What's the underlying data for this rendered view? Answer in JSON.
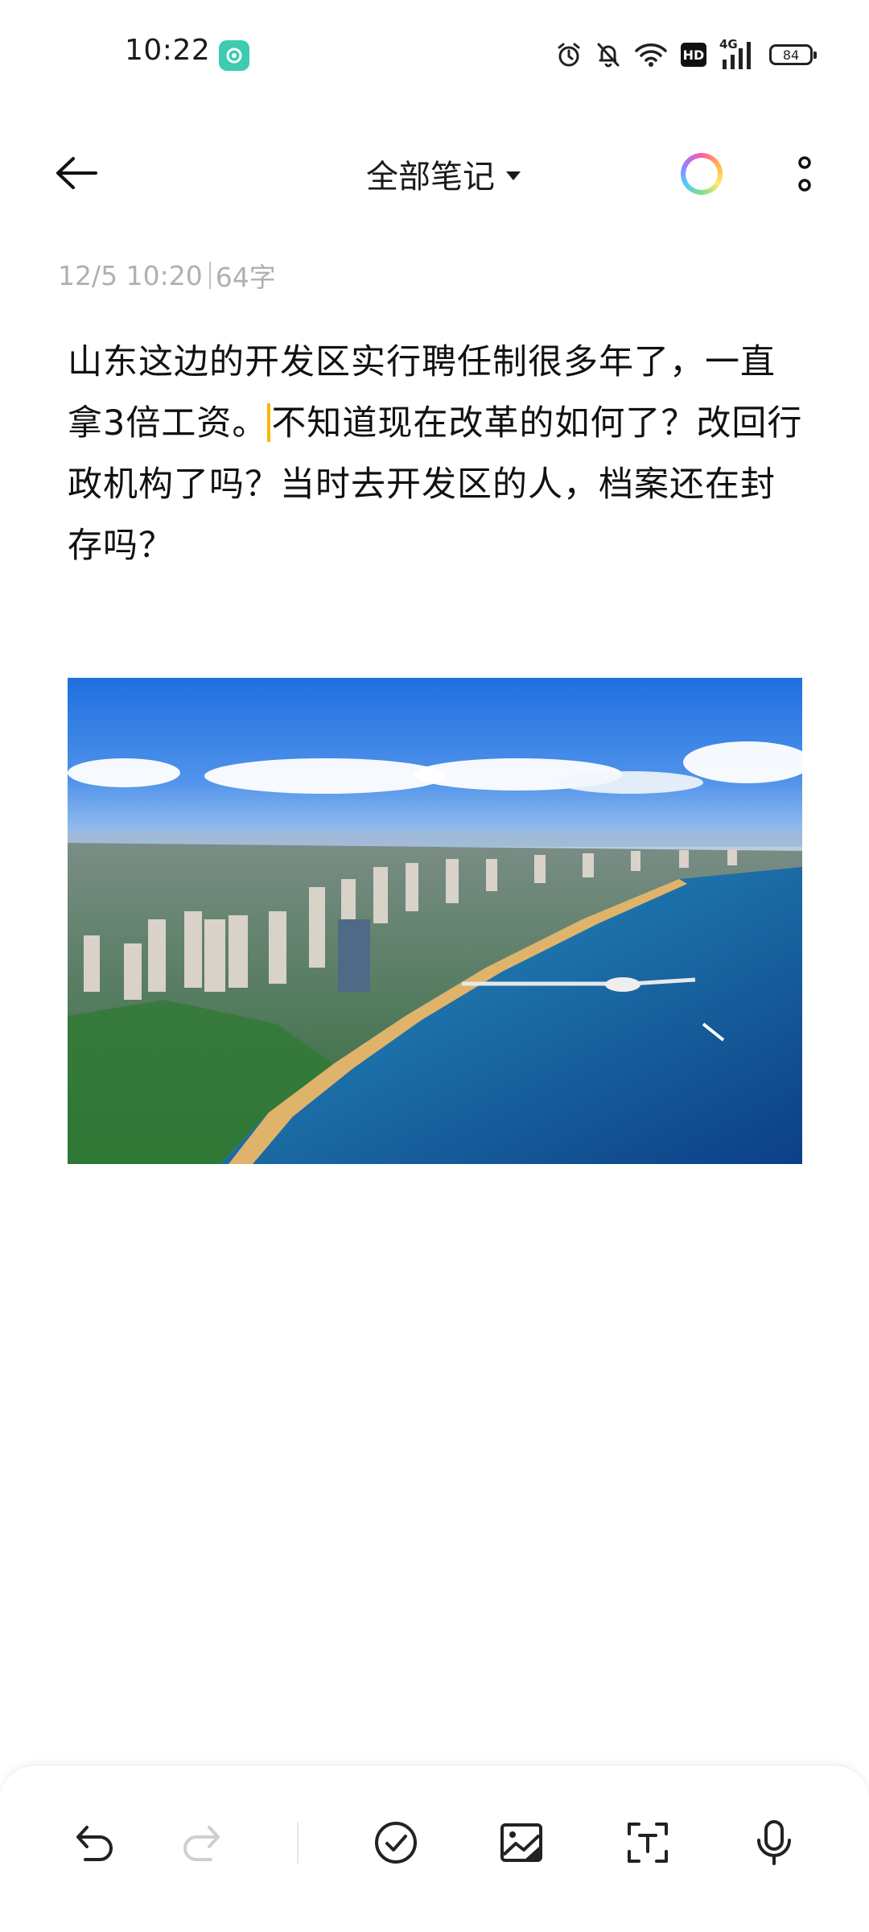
{
  "status_bar": {
    "time": "10:22",
    "hd_label": "HD",
    "network_label": "4G",
    "battery_level": "84"
  },
  "header": {
    "title": "全部笔记"
  },
  "note": {
    "date": "12/5 10:20",
    "word_count": "64字",
    "text_before_cursor": "山东这边的开发区实行聘任制很多年了，一直拿3倍工资。",
    "text_after_cursor": "不知道现在改革的如何了？改回行政机构了吗？当时去开发区的人，档案还在封存吗？"
  },
  "icons": {
    "back": "arrow-left-icon",
    "theme": "color-ring-icon",
    "more": "more-vertical-icon",
    "undo": "undo-icon",
    "redo": "redo-icon",
    "checklist": "check-circle-icon",
    "image": "image-icon",
    "text_scan": "text-scan-icon",
    "voice": "microphone-icon"
  },
  "colors": {
    "caret": "#f5b800",
    "meta_text": "#b0b0b0",
    "status_app": "#3ecbb0"
  }
}
